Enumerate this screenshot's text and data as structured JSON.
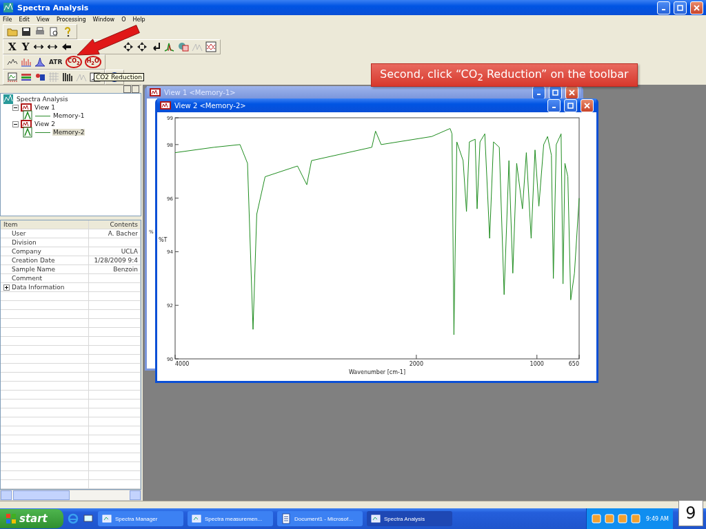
{
  "window": {
    "title": "Spectra Analysis"
  },
  "menu": [
    "File",
    "Edit",
    "View",
    "Processing",
    "Window",
    "O",
    "Help"
  ],
  "toolbar": {
    "axis_buttons": [
      "X",
      "Y"
    ],
    "correction_buttons": [
      {
        "label": "ATR",
        "kind": "plain"
      },
      {
        "label": "CO$_{2}$",
        "kind": "crossed"
      },
      {
        "label": "H$_{2}$O",
        "kind": "crossed"
      }
    ],
    "tooltip": "CO2 Reduction"
  },
  "tree": [
    {
      "label": "Spectra Analysis",
      "kind": "root",
      "children": [
        {
          "label": "View 1",
          "kind": "view",
          "expanded": true,
          "selected": false,
          "children": [
            {
              "label": "Memory-1",
              "kind": "memory",
              "selected": false
            }
          ]
        },
        {
          "label": "View 2",
          "kind": "view",
          "expanded": true,
          "selected": false,
          "children": [
            {
              "label": "Memory-2",
              "kind": "memory",
              "selected": true
            }
          ]
        }
      ]
    }
  ],
  "properties": {
    "columns": [
      "Item",
      "Contents"
    ],
    "rows": [
      {
        "kind": "field",
        "item": "User",
        "contents": "A. Bacher"
      },
      {
        "kind": "field",
        "item": "Division"
      },
      {
        "kind": "field",
        "item": "Company",
        "contents": "UCLA"
      },
      {
        "kind": "field",
        "item": "Creation Date",
        "contents": "1/28/2009 9:4"
      },
      {
        "kind": "field",
        "item": "Sample Name",
        "contents": "Benzoin"
      },
      {
        "kind": "field",
        "item": "Comment"
      },
      {
        "kind": "group",
        "item": "Data Information",
        "expanded": false
      }
    ]
  },
  "view1": {
    "title": "View 1 <Memory-1>",
    "ylabel": "%"
  },
  "view2": {
    "title": "View 2 <Memory-2>",
    "chart_data": {
      "type": "line",
      "xlabel": "Wavenumber [cm-1]",
      "ylabel": "%T",
      "x": [
        4000,
        3677,
        3462,
        3400,
        3354,
        3323,
        3254,
        2985,
        2908,
        2869,
        2369,
        2338,
        2292,
        1872,
        1720,
        1704,
        1688,
        1664,
        1612,
        1584,
        1560,
        1512,
        1496,
        1472,
        1432,
        1392,
        1360,
        1312,
        1272,
        1232,
        1200,
        1168,
        1120,
        1088,
        1048,
        1016,
        984,
        944,
        912,
        880,
        864,
        840,
        800,
        784,
        768,
        744,
        720,
        689,
        650
      ],
      "series": [
        {
          "color": "#1e8c1e",
          "values": [
            97.7,
            97.9,
            98.0,
            97.3,
            91.1,
            95.4,
            96.8,
            97.2,
            96.5,
            97.4,
            97.9,
            98.5,
            98.0,
            98.3,
            98.6,
            98.4,
            90.9,
            98.1,
            97.4,
            95.5,
            98.1,
            98.2,
            95.6,
            98.1,
            98.4,
            94.5,
            98.1,
            97.9,
            92.4,
            97.4,
            93.2,
            97.3,
            95.6,
            97.7,
            94.5,
            97.8,
            95.7,
            98.0,
            98.3,
            97.6,
            93.0,
            98.0,
            98.4,
            92.8,
            97.3,
            96.8,
            92.2,
            93.2,
            96.0
          ]
        }
      ],
      "xlim": [
        4000,
        650
      ],
      "ylim": [
        90,
        99
      ],
      "xticks": [
        4000,
        2000,
        1000,
        650
      ],
      "yticks": [
        90,
        92,
        94,
        96,
        98,
        99
      ]
    }
  },
  "taskbar": {
    "start": "start",
    "tasks": [
      {
        "label": "Spectra Manager",
        "selected": false
      },
      {
        "label": "Spectra measuremen...",
        "selected": false
      },
      {
        "label": "Document1 - Microsof...",
        "selected": false
      },
      {
        "label": "Spectra Analysis",
        "selected": true
      }
    ],
    "time": "9:49 AM"
  },
  "callout": "Second, click “CO$_{2}$ Reduction” on the toolbar",
  "slide_number": "9"
}
